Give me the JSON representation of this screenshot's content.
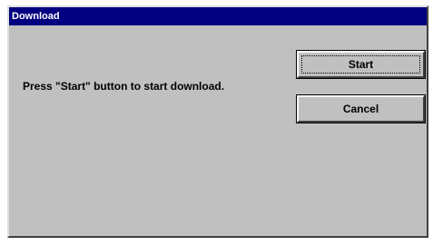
{
  "dialog": {
    "title": "Download",
    "message": "Press \"Start\" button to start download.",
    "buttons": {
      "start_label": "Start",
      "cancel_label": "Cancel"
    }
  }
}
